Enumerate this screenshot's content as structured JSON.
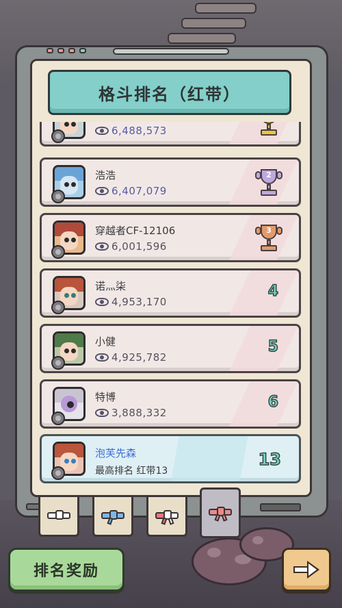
{
  "title": "格斗排名（红带）",
  "colors": {
    "banner": "#84cfc9",
    "row_bg": "#f1e8e6",
    "my_row_bg": "#dff0f5",
    "gold": "#f0c23a",
    "silver": "#bfa8e0",
    "bronze": "#e39a6a",
    "rank_number": "#7fcfc0",
    "reward_button": "#a9d99a",
    "next_button": "#f0c98e"
  },
  "rankings": [
    {
      "rank": 1,
      "name": "",
      "views": "6,488,573",
      "badge": "gold-trophy-icon"
    },
    {
      "rank": 2,
      "name": "浩浩",
      "views": "6,407,079",
      "badge": "silver-trophy-icon",
      "trophy_num": "2"
    },
    {
      "rank": 3,
      "name": "穿越者CF-12106",
      "views": "6,001,596",
      "badge": "bronze-trophy-icon",
      "trophy_num": "3"
    },
    {
      "rank": 4,
      "name": "诺灬柒",
      "views": "4,953,170",
      "rank_label": "4"
    },
    {
      "rank": 5,
      "name": "小健",
      "views": "4,925,782",
      "rank_label": "5"
    },
    {
      "rank": 6,
      "name": "特博",
      "views": "3,888,332",
      "rank_label": "6"
    }
  ],
  "my_entry": {
    "name": "泡芙先森",
    "best_rank": "最高排名 红带13",
    "rank": "13"
  },
  "belt_tabs": [
    {
      "icon": "white-belt-icon",
      "color": "#ffffff",
      "active": false
    },
    {
      "icon": "blue-belt-icon",
      "color": "#7fb6e6",
      "active": false
    },
    {
      "icon": "red-white-belt-icon",
      "color": "#e77b7b",
      "active": false
    },
    {
      "icon": "red-belt-icon",
      "color": "#e88a8a",
      "active": true
    }
  ],
  "reward_button": "排名奖励",
  "next_button_icon": "right-arrow-icon"
}
